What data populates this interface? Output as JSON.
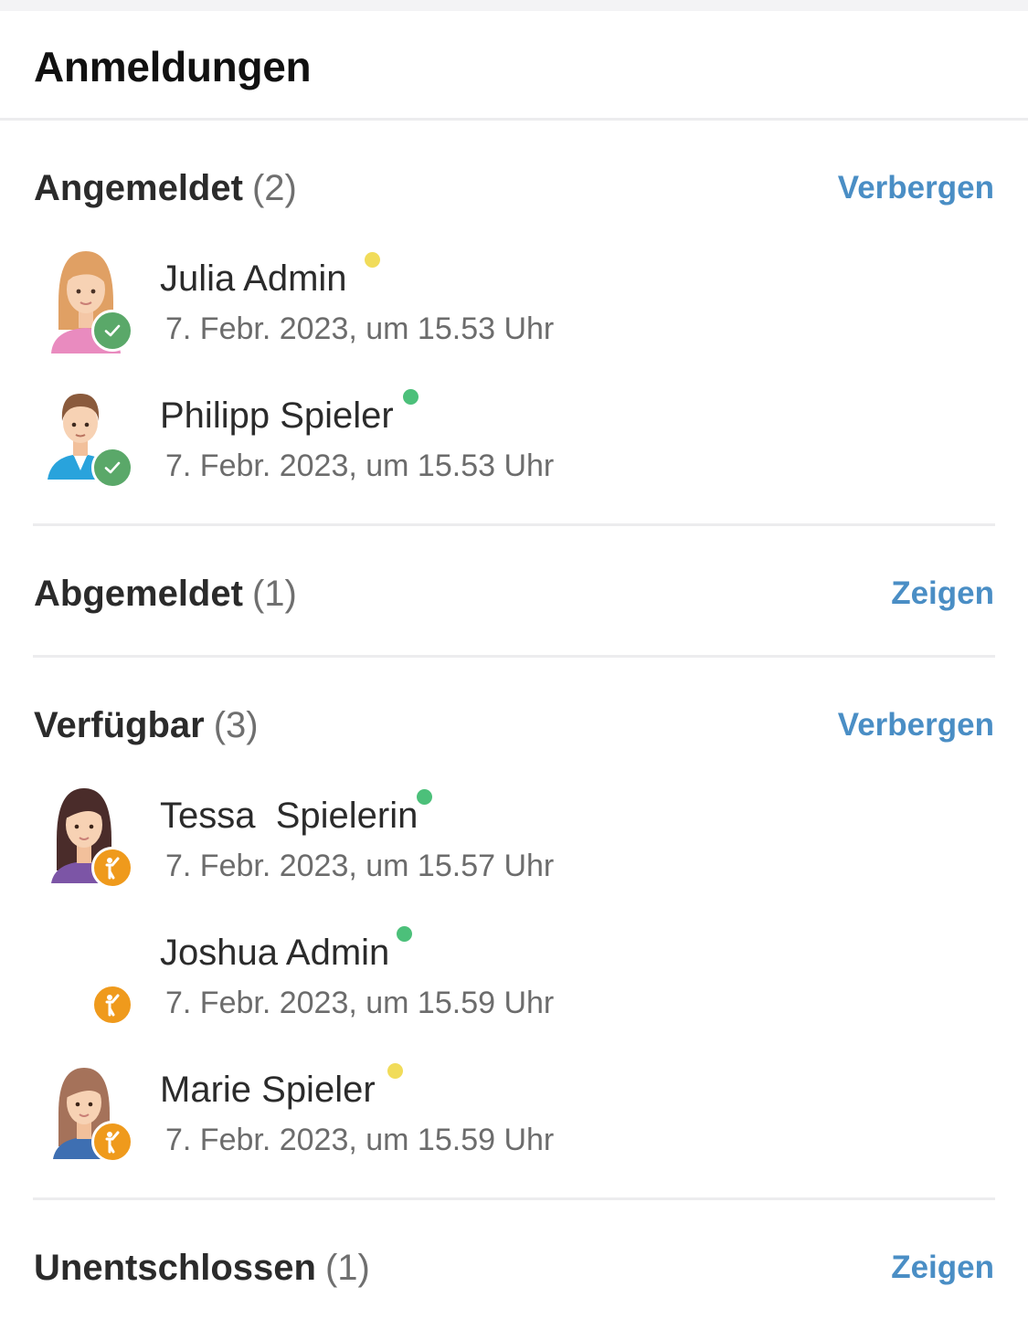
{
  "page": {
    "title": "Anmeldungen"
  },
  "colors": {
    "accent": "#4a8ec5",
    "confirmed_badge": "#5aa869",
    "available_badge": "#ef9a1c",
    "presence_online": "#4cc07a",
    "presence_away": "#f1dc5a"
  },
  "sections": [
    {
      "name": "Angemeldet",
      "count": "(2)",
      "toggle": "Verbergen",
      "members": [
        {
          "name": "Julia Admin",
          "time": "7. Febr. 2023, um 15.53 Uhr",
          "presence": "away",
          "badge": "check-icon"
        },
        {
          "name": "Philipp Spieler",
          "time": "7. Febr. 2023, um 15.53 Uhr",
          "presence": "online",
          "badge": "check-icon"
        }
      ]
    },
    {
      "name": "Abgemeldet",
      "count": "(1)",
      "toggle": "Zeigen",
      "members": []
    },
    {
      "name": "Verfügbar",
      "count": "(3)",
      "toggle": "Verbergen",
      "members": [
        {
          "name": "Tessa  Spielerin",
          "time": "7. Febr. 2023, um 15.57 Uhr",
          "presence": "online",
          "badge": "person-raising-hand-icon"
        },
        {
          "name": "Joshua Admin",
          "time": "7. Febr. 2023, um 15.59 Uhr",
          "presence": "online",
          "badge": "person-raising-hand-icon"
        },
        {
          "name": "Marie Spieler",
          "time": "7. Febr. 2023, um 15.59 Uhr",
          "presence": "away",
          "badge": "person-raising-hand-icon"
        }
      ]
    },
    {
      "name": "Unentschlossen",
      "count": "(1)",
      "toggle": "Zeigen",
      "members": []
    }
  ]
}
